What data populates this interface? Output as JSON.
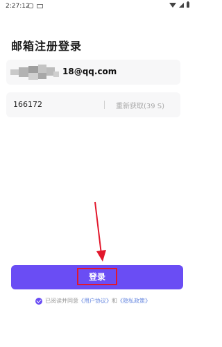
{
  "status_bar": {
    "time": "2:27:12"
  },
  "page": {
    "title": "邮箱注册登录"
  },
  "email_field": {
    "value_suffix": "18@qq.com"
  },
  "code_field": {
    "value": "166172",
    "divider": "|",
    "resend": "重新获取(39 S)"
  },
  "login_button": {
    "label": "登录"
  },
  "agreement": {
    "prefix": "已阅读并同意",
    "user_agreement": "《用户协议》",
    "and": "和",
    "privacy_policy": "《隐私政策》",
    "checked": true
  },
  "colors": {
    "accent": "#6a4df4",
    "highlight": "#e2182c",
    "link": "#6a8ae0"
  }
}
